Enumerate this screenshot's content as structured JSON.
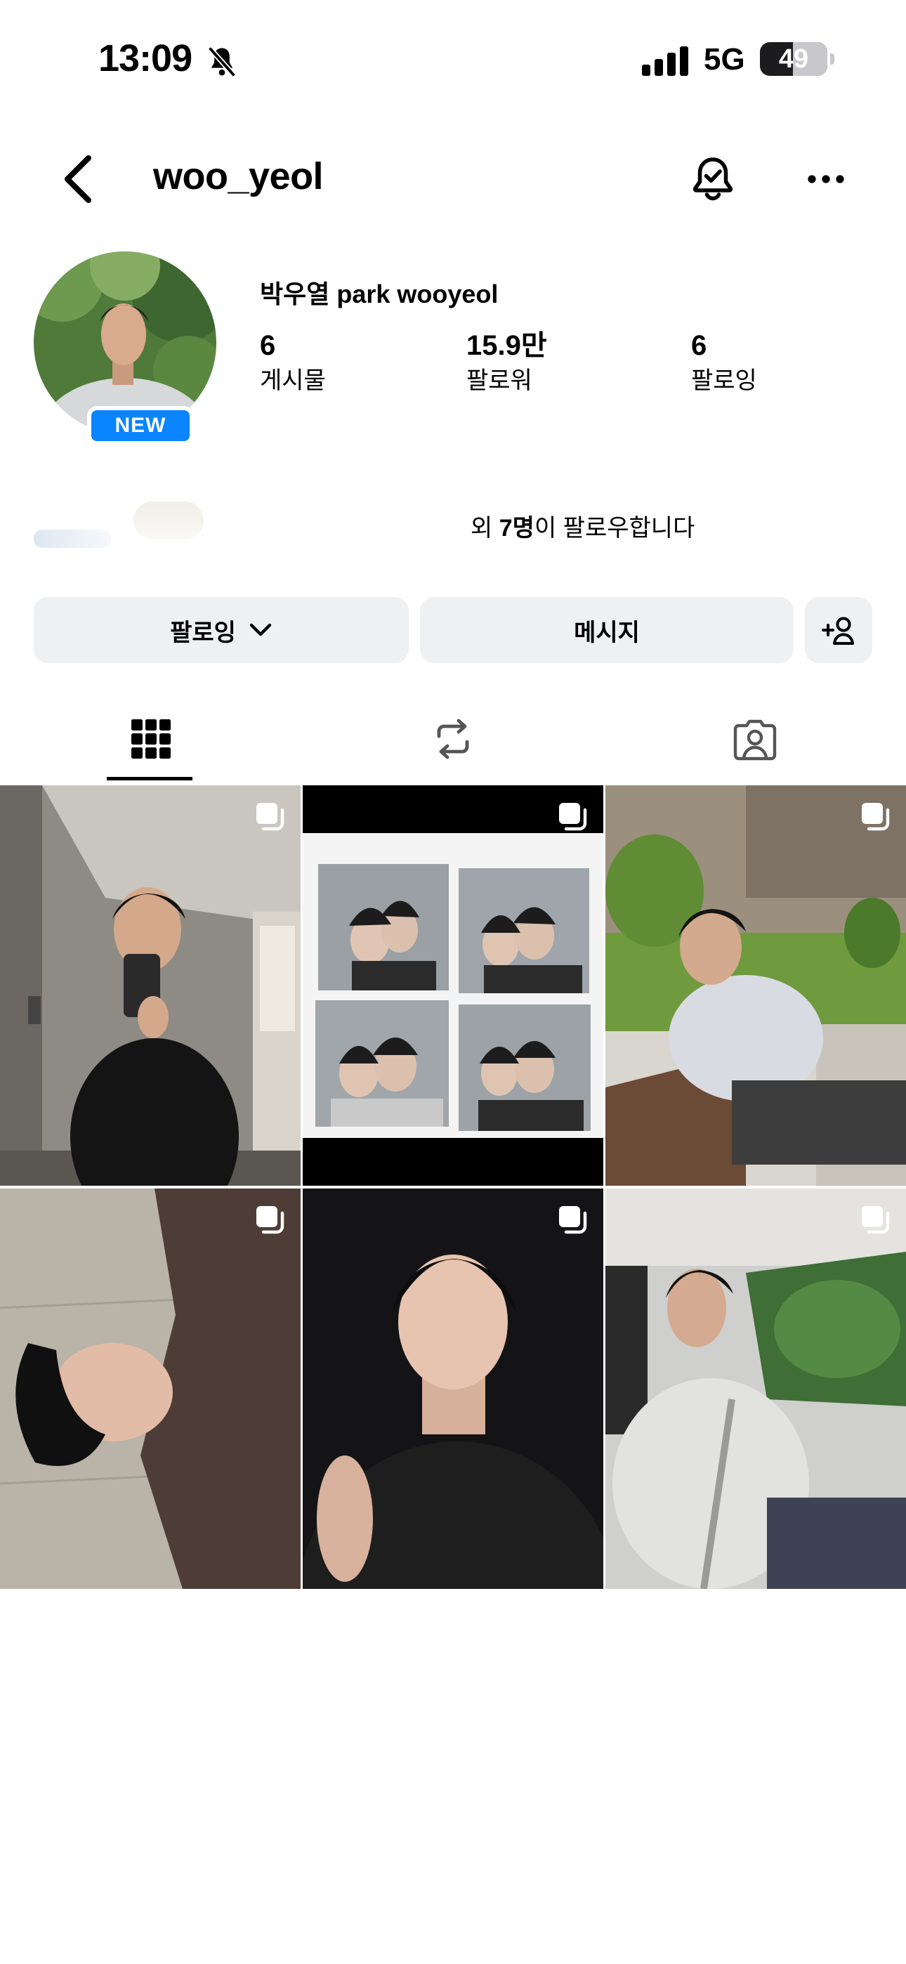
{
  "status_bar": {
    "time": "13:09",
    "network": "5G",
    "battery": "49",
    "battery_level": 0.49
  },
  "header": {
    "username": "woo_yeol",
    "icons": [
      "chevron-left-icon",
      "bell-check-icon",
      "more-horizontal-icon"
    ]
  },
  "profile": {
    "full_name": "박우열 park wooyeol",
    "new_badge": "NEW",
    "stats": [
      {
        "value": "6",
        "label": "게시물"
      },
      {
        "value": "15.9만",
        "label": "팔로워"
      },
      {
        "value": "6",
        "label": "팔로잉"
      }
    ],
    "followed_by": {
      "prefix": "외 ",
      "count": "7명",
      "suffix": "이 팔로우합니다"
    }
  },
  "actions": {
    "follow_label": "팔로잉",
    "message_label": "메시지"
  },
  "tabs": [
    {
      "icon": "grid-icon",
      "active": true
    },
    {
      "icon": "reels-repost-icon",
      "active": false
    },
    {
      "icon": "tagged-person-icon",
      "active": false
    }
  ],
  "colors": {
    "accent": "#0a84ff",
    "button_bg": "#eff0f2"
  }
}
